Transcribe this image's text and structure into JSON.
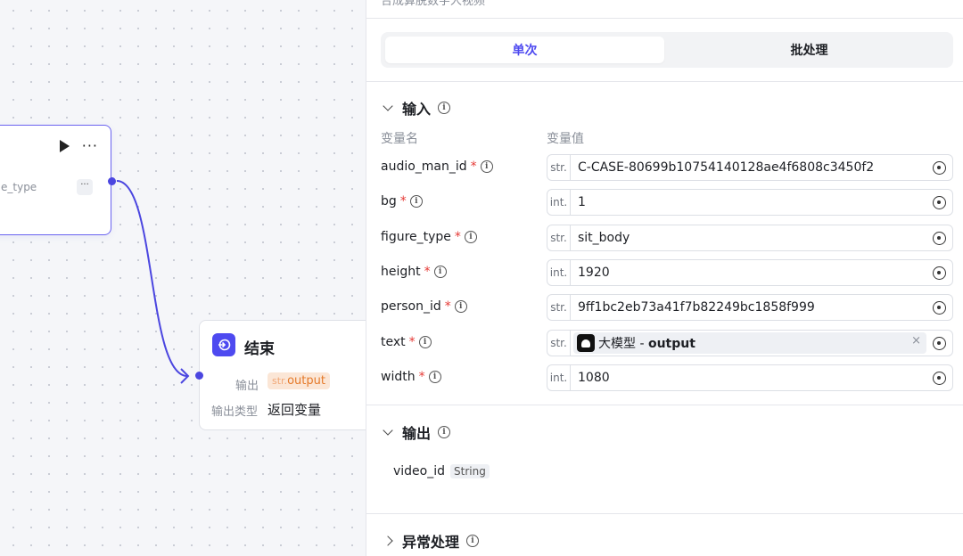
{
  "canvas": {
    "llm_node": {
      "output_name": "e_type",
      "more_label": "···"
    },
    "end_node": {
      "title": "结束",
      "output_label": "输出",
      "output_tag_prefix": "str.",
      "output_tag_name": "output",
      "output_type_label": "输出类型",
      "output_type_value": "返回变量"
    }
  },
  "panel": {
    "top_title": "合成算脱数字人视频",
    "tabs": [
      "单次",
      "批处理"
    ],
    "input_section": {
      "title": "输入",
      "col_name": "变量名",
      "col_value": "变量值",
      "rows": [
        {
          "name": "audio_man_id",
          "type": "str.",
          "value": "C-CASE-80699b10754140128ae4f6808c3450f2"
        },
        {
          "name": "bg",
          "type": "int.",
          "value": "1"
        },
        {
          "name": "figure_type",
          "type": "str.",
          "value": "sit_body"
        },
        {
          "name": "height",
          "type": "int.",
          "value": "1920"
        },
        {
          "name": "person_id",
          "type": "str.",
          "value": "9ff1bc2eb73a41f7b82249bc1858f999"
        },
        {
          "name": "text",
          "type": "str.",
          "ref_node": "大模型",
          "ref_output": "output"
        },
        {
          "name": "width",
          "type": "int.",
          "value": "1080"
        }
      ],
      "required_mark": "*"
    },
    "output_section": {
      "title": "输出",
      "items": [
        {
          "name": "video_id",
          "type": "String"
        }
      ]
    },
    "error_section": {
      "title": "异常处理"
    }
  },
  "colors": {
    "accent": "#4e4af0",
    "required": "#e53935",
    "tag_bg": "#fbe6d6",
    "tag_text": "#e57a2a"
  }
}
